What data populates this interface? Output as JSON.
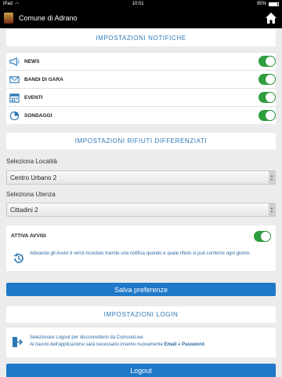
{
  "status": {
    "device": "iPad",
    "time": "10:01",
    "battery": "95%"
  },
  "app": {
    "title": "Comune di Adrano"
  },
  "notifiche": {
    "header": "IMPOSTAZIONI NOTIFICHE",
    "items": [
      {
        "label": "NEWS",
        "on": true
      },
      {
        "label": "BANDI DI GARA",
        "on": true
      },
      {
        "label": "EVENTI",
        "on": true
      },
      {
        "label": "SONDAGGI",
        "on": true
      }
    ]
  },
  "rifiuti": {
    "header": "IMPOSTAZIONI RIFIUTI DIFFERENZIATI",
    "localita_label": "Seleziona Località",
    "localita_value": "Centro Urbano 2",
    "utenza_label": "Seleziona Utenza",
    "utenza_value": "Cittadini 2",
    "avvisi_label": "ATTIVA AVVISI",
    "avvisi_on": true,
    "avvisi_text": "Attivando gli Avvisi ti verrà ricordato tramite una notifica quando e quale rifiuto si può conferire ogni giorno."
  },
  "save_button": "Salva preferenze",
  "login": {
    "header": "IMPOSTAZIONI LOGIN",
    "line1": "Selezionare Logout per disconnettersi da ComuneLive.",
    "line2_pre": "Al riavvio dell'applicazione sarà necessario inserire nuovamente ",
    "line2_email": "Email",
    "line2_mid": " e ",
    "line2_pw": "Password",
    "line2_end": ".",
    "logout_button": "Logout"
  },
  "colors": {
    "accent": "#2a78b8",
    "toggle_on": "#2e9e3e",
    "button": "#1f78c8"
  }
}
